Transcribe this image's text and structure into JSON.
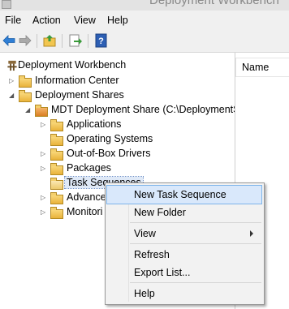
{
  "window": {
    "title": "Deployment Workbench"
  },
  "menubar": {
    "items": [
      {
        "label": "File"
      },
      {
        "label": "Action"
      },
      {
        "label": "View"
      },
      {
        "label": "Help"
      }
    ]
  },
  "tree": {
    "root": "Deployment Workbench",
    "info_center": "Information Center",
    "deployment_shares": "Deployment Shares",
    "mdt_share": "MDT Deployment Share (C:\\DeploymentS",
    "applications": "Applications",
    "operating_systems": "Operating Systems",
    "drivers": "Out-of-Box Drivers",
    "packages": "Packages",
    "task_sequences": "Task Sequences",
    "advanced": "Advance",
    "monitoring": "Monitori"
  },
  "list": {
    "column_name": "Name"
  },
  "context_menu": {
    "new_task_sequence": "New Task Sequence",
    "new_folder": "New Folder",
    "view": "View",
    "refresh": "Refresh",
    "export_list": "Export List...",
    "help": "Help"
  },
  "colors": {
    "highlight": "#d9e8fb",
    "menu_bg": "#f2f2f2",
    "folder": "#e9b33a"
  },
  "icons": [
    "back-arrow-icon",
    "forward-arrow-icon",
    "up-folder-icon",
    "export-icon",
    "help-icon"
  ]
}
